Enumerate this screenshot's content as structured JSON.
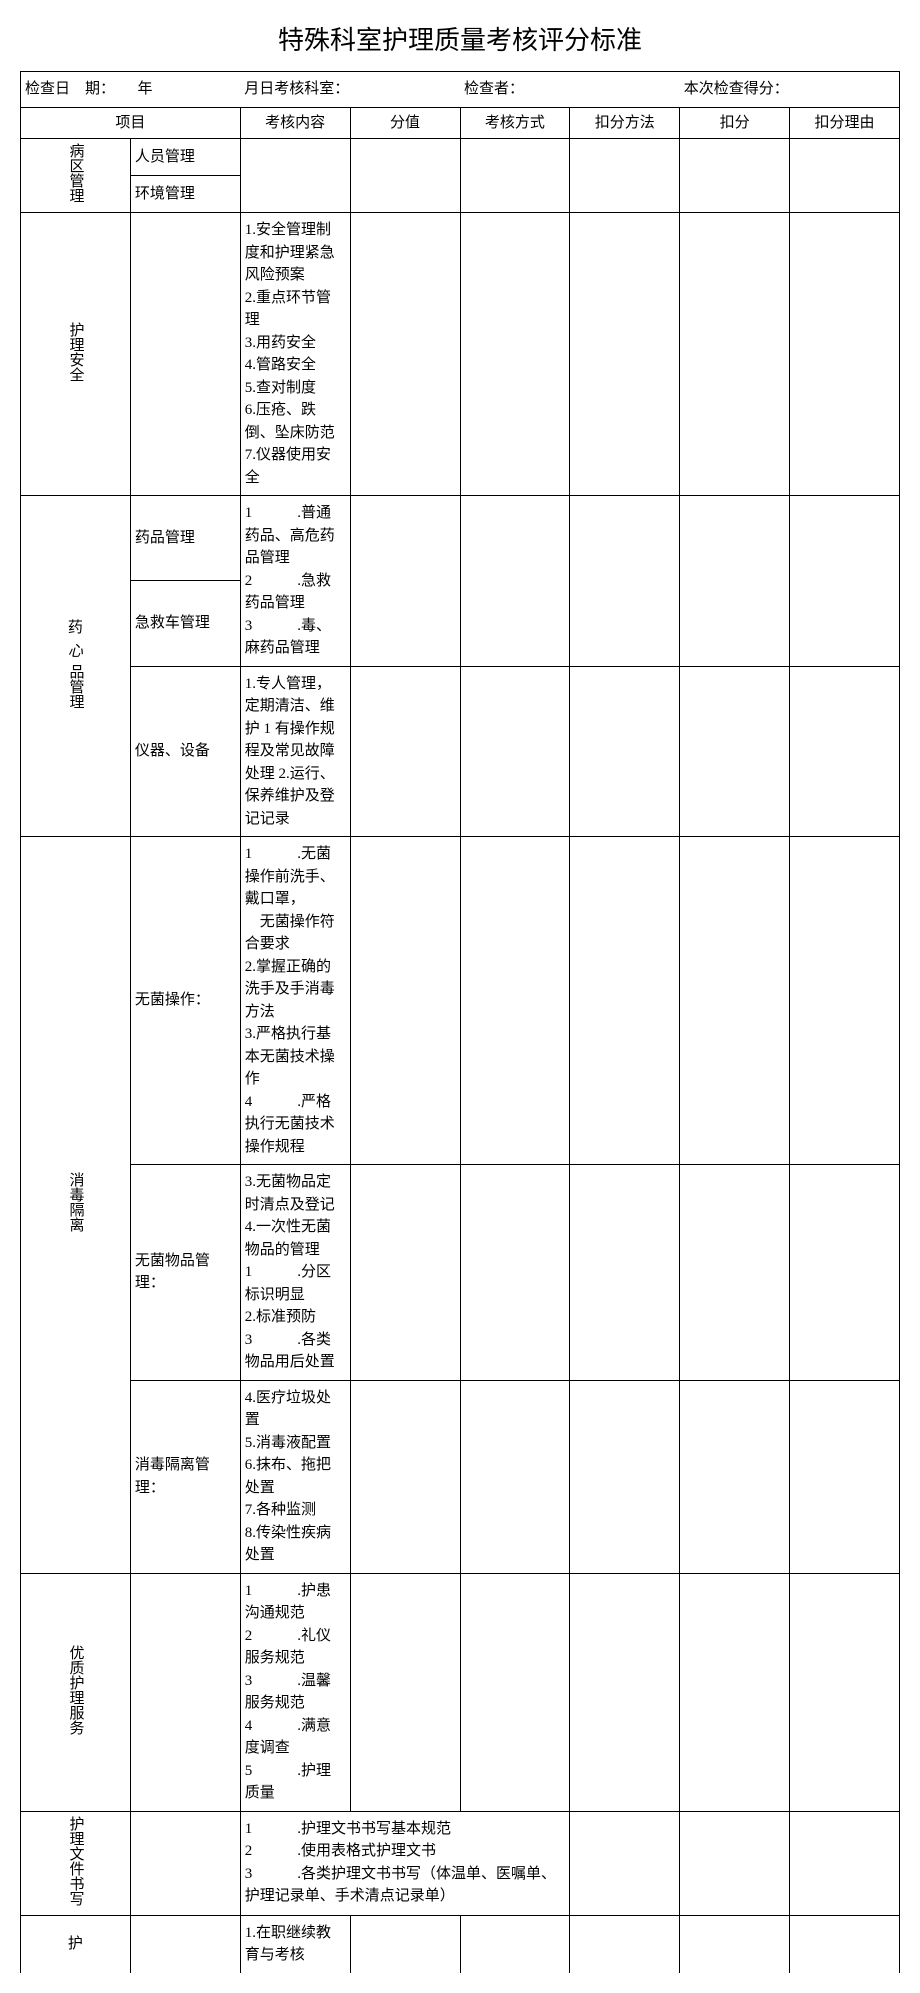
{
  "title": "特殊科室护理质量考核评分标准",
  "header": {
    "date_label": "检查日　期：",
    "year": "年",
    "dept_label": "月日考核科室：",
    "checker_label": "检查者：",
    "score_label": "本次检查得分："
  },
  "cols": {
    "project": "项目",
    "content": "考核内容",
    "score": "分值",
    "mode": "考核方式",
    "dmethod": "扣分方法",
    "dscore": "扣分",
    "dreason": "扣分理由"
  },
  "sections": {
    "ward": {
      "label": "病区管理",
      "sub1": "人员管理",
      "sub2": "环境管理"
    },
    "safety": {
      "label": "护理安全",
      "content": "1.安全管理制度和护理紧急风险预案\n2.重点环节管理\n3.用药安全\n4.管路安全\n5.查对制度\n6.压疮、跌倒、坠床防范\n7.仪器使用安全"
    },
    "drug": {
      "label1": "药",
      "label2": "心",
      "label3": "品管理",
      "sub1": "药品管理",
      "sub1_content": "1　　　.普通药品、高危药品管理\n2　　　.急救药品管理\n3　　　.毒、麻药品管理",
      "sub2": "急救车管理",
      "sub3": "仪器、设备",
      "sub3_content": "1.专人管理，定期清洁、维护 1 有操作规程及常见故障处理 2.运行、保养维护及登记记录"
    },
    "disinfect": {
      "label": "消毒隔离",
      "sub1": "无菌操作：",
      "sub1_content": "1　　　.无菌操作前洗手、戴口罩，\n　无菌操作符合要求\n2.掌握正确的洗手及手消毒方法\n3.严格执行基本无菌技术操作\n4　　　.严格执行无菌技术操作规程",
      "sub2": "无菌物品管理：",
      "sub2_content": "3.无菌物品定时清点及登记\n4.一次性无菌物品的管理\n1　　　.分区标识明显\n2.标准预防\n3　　　.各类物品用后处置",
      "sub3": "消毒隔离管理：",
      "sub3_content": "4.医疗垃圾处置\n5.消毒液配置\n6.抹布、拖把处置\n7.各种监测\n8.传染性疾病处置"
    },
    "quality": {
      "label": "优质护理服务",
      "content": "1　　　.护患沟通规范\n2　　　.礼仪服务规范\n3　　　.温馨服务规范\n4　　　.满意度调查\n5　　　.护理质量"
    },
    "doc": {
      "label": "护理文件书写",
      "content": "1　　　.护理文书书写基本规范\n2　　　.使用表格式护理文书\n3　　　.各类护理文书书写（体温单、医嘱单、护理记录单、手术清点记录单）"
    },
    "edu": {
      "label": "护",
      "content": "1.在职继续教育与考核"
    }
  }
}
